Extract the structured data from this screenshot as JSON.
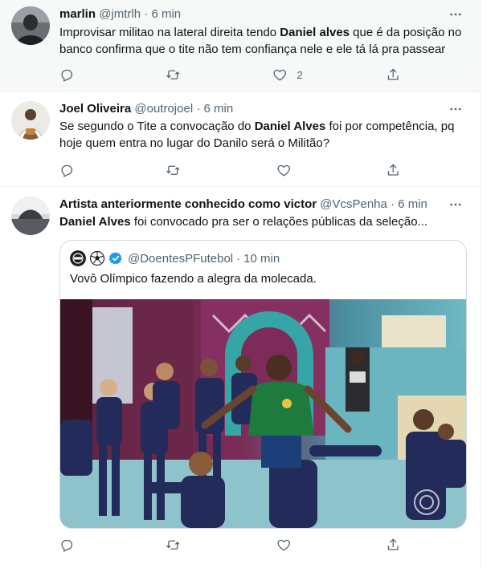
{
  "tweets": [
    {
      "name": "marlin",
      "handle": "@jmtrlh",
      "dot": "·",
      "time": "6 min",
      "text_line1_a": "Improvisar militao na lateral direita tendo ",
      "text_line1_b": "Daniel alves",
      "text_line1_c": " que é da posição no",
      "text_line2": "banco confirma que o tite não tem confiança nele e ele tá lá pra passear",
      "like_count": "2"
    },
    {
      "name": "Joel Oliveira",
      "handle": "@outrojoel",
      "dot": "·",
      "time": "6 min",
      "text_line1_a": "Se segundo o Tite a convocação do ",
      "text_line1_b": "Daniel Alves",
      "text_line1_c": " foi por competência, pq",
      "text_line2": "hoje quem entra no lugar do Danilo será o Militão?"
    },
    {
      "name": "Artista anteriormente conhecido como victor",
      "handle": "@VcsPenha",
      "dot": "·",
      "time": "6 min",
      "text_bold": "Daniel Alves",
      "text_rest": " foi convocado pra ser o relações públicas da seleção...",
      "quote": {
        "handle": "@DoentesPFutebol",
        "dot": "·",
        "time": "10 min",
        "text": "Vovô Olímpico fazendo a alegra da molecada."
      }
    }
  ],
  "icons": {
    "more": "more-horizontal-icon",
    "reply": "reply-icon",
    "retweet": "retweet-icon",
    "like": "heart-icon",
    "share": "share-icon",
    "verified": "verified-badge-icon",
    "football": "soccer-ball-icon"
  },
  "colors": {
    "text": "#0f1419",
    "secondary": "#536471",
    "border": "#cfd9de",
    "verified": "#1d9bf0",
    "shirt_green": "#1f7a3e",
    "kids_navy": "#232b5a"
  }
}
